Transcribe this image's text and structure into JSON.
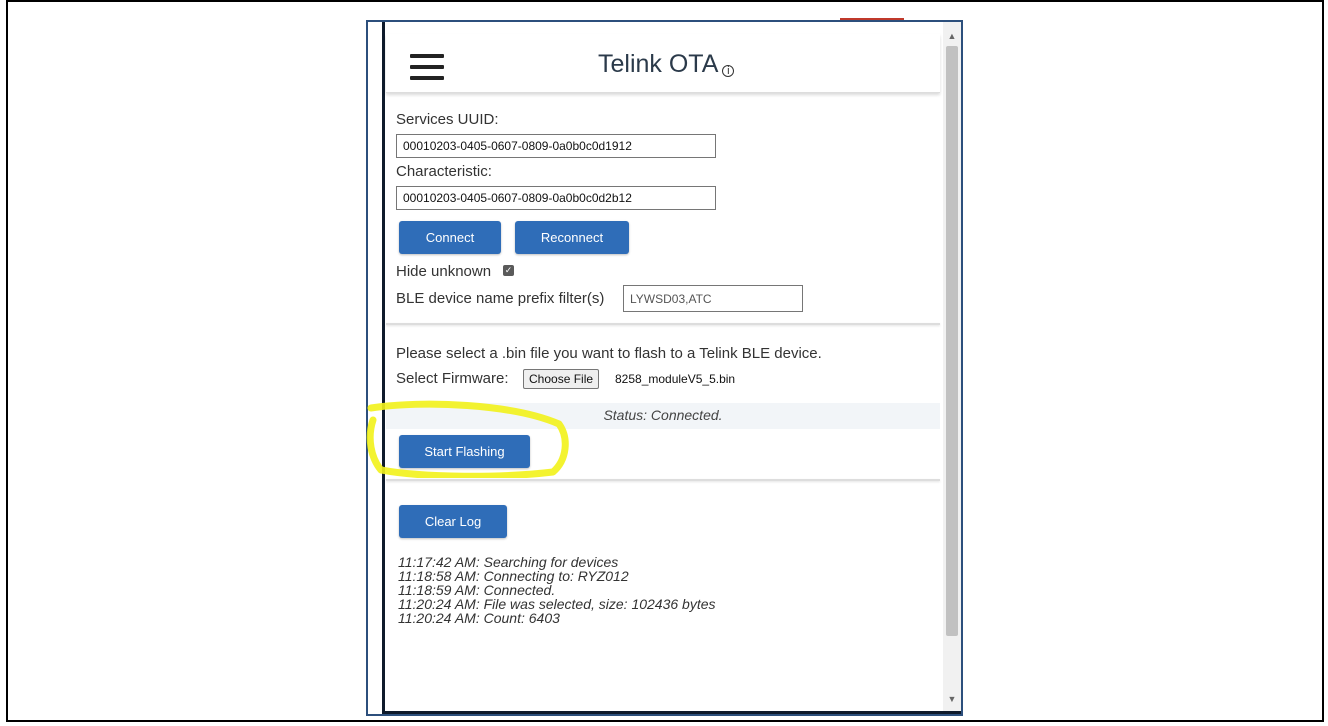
{
  "header": {
    "title": "Telink OTA",
    "info_icon": "info-icon"
  },
  "services": {
    "uuid_label": "Services UUID:",
    "uuid_value": "00010203-0405-0607-0809-0a0b0c0d1912",
    "char_label": "Characteristic:",
    "char_value": "00010203-0405-0607-0809-0a0b0c0d2b12"
  },
  "buttons": {
    "connect": "Connect",
    "reconnect": "Reconnect",
    "start_flashing": "Start Flashing",
    "clear_log": "Clear Log"
  },
  "filters": {
    "hide_unknown_label": "Hide unknown",
    "hide_unknown_checked": true,
    "prefix_label": "BLE device name prefix filter(s)",
    "prefix_value": "LYWSD03,ATC"
  },
  "firmware": {
    "instruction": "Please select a .bin file you want to flash to a Telink BLE device.",
    "select_label": "Select Firmware:",
    "choose_file_label": "Choose File",
    "file_name": "8258_moduleV5_5.bin"
  },
  "status": {
    "text": "Status: Connected."
  },
  "log": [
    "11:17:42 AM: Searching for devices",
    "11:18:58 AM: Connecting to: RYZ012",
    "11:18:59 AM: Connected.",
    "11:20:24 AM: File was selected, size: 102436 bytes",
    "11:20:24 AM: Count: 6403"
  ],
  "colors": {
    "button": "#2f6db8",
    "highlight": "#f2f21a",
    "window_border": "#2c4f7c"
  }
}
